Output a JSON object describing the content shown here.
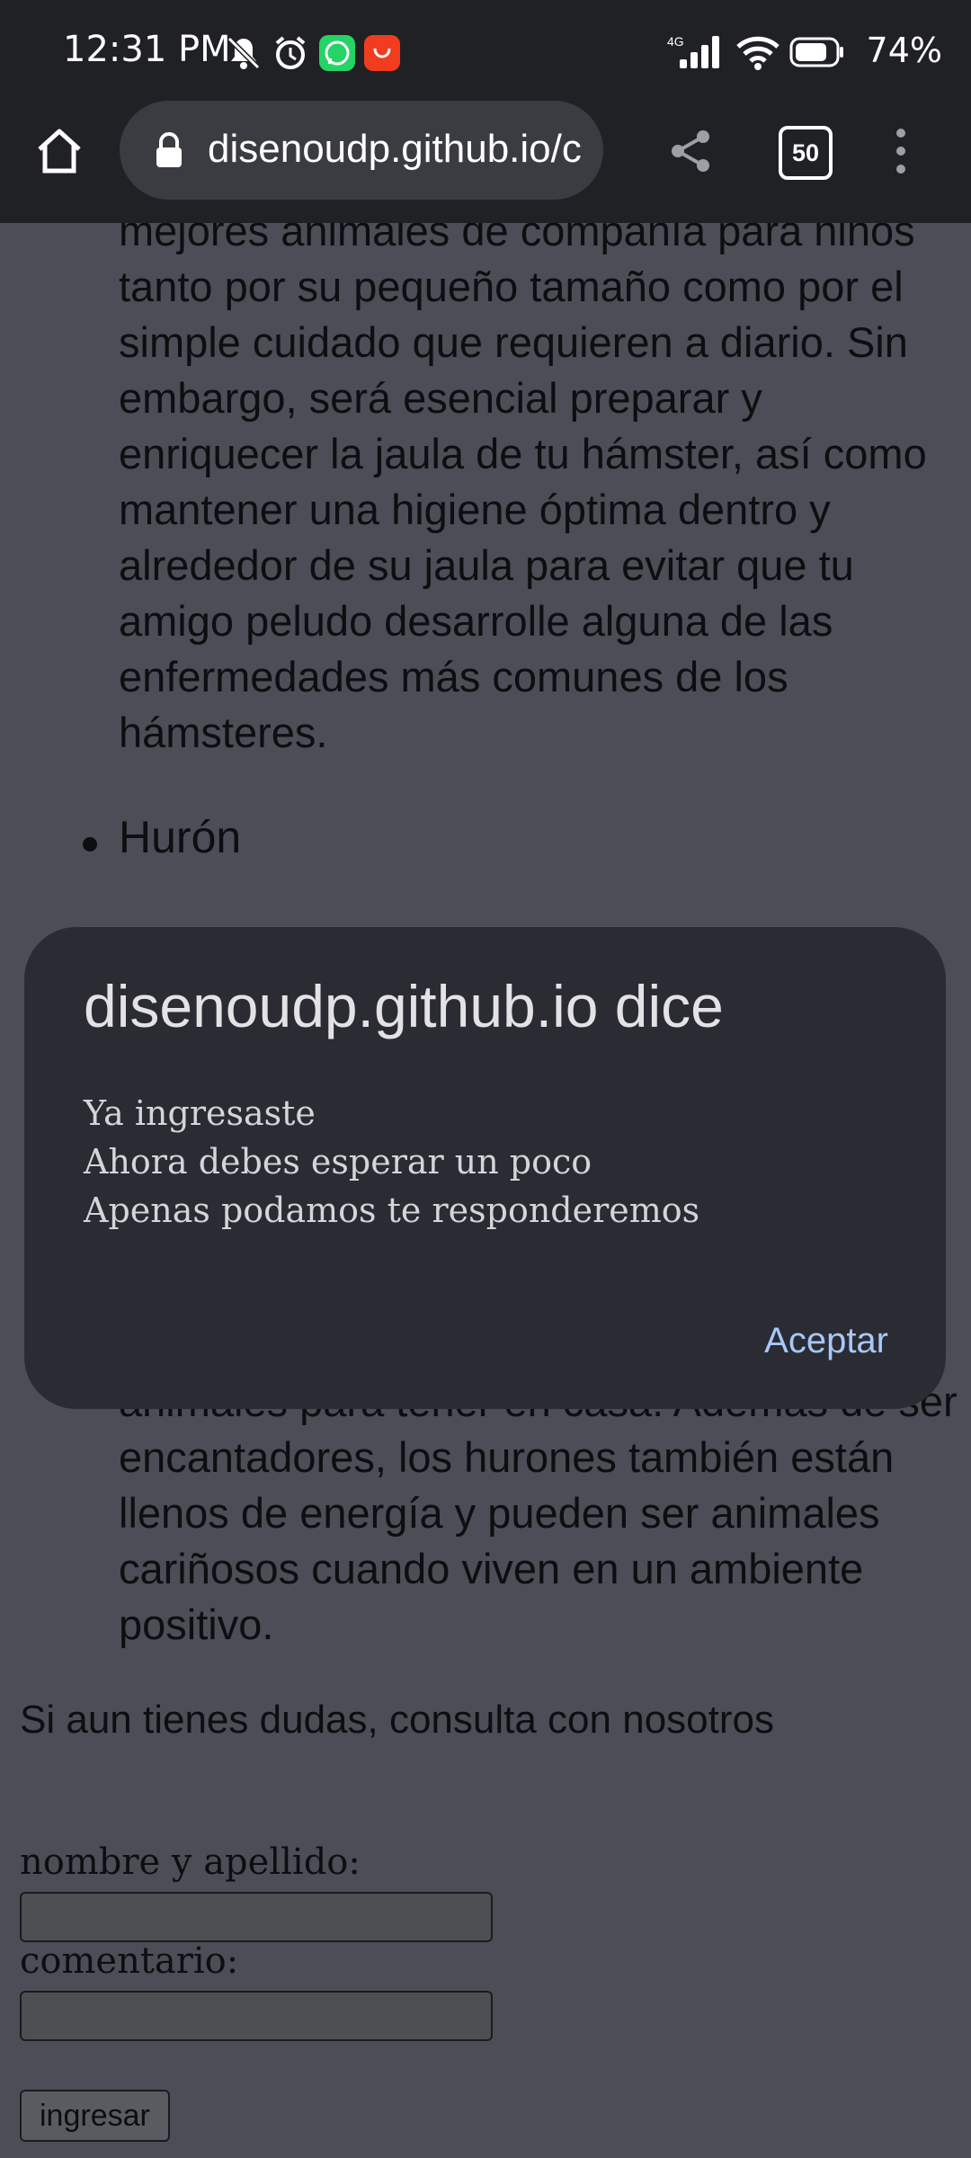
{
  "status_bar": {
    "time": "12:31 PM",
    "network": "4G",
    "battery": "74%",
    "icons": [
      "mute-icon",
      "alarm-icon",
      "whatsapp-icon",
      "shopping-app-icon",
      "signal-icon",
      "wifi-icon",
      "battery-icon"
    ]
  },
  "browser": {
    "url": "disenoudp.github.io/c",
    "tab_count": "50",
    "icons": [
      "home-icon",
      "lock-icon",
      "share-icon",
      "tabs-icon",
      "more-menu-icon"
    ]
  },
  "content": {
    "paragraph_top": "mejores animales de compañía para niños tanto por su pequeño tamaño como por el simple cuidado que requieren a diario. Sin embargo, será esencial preparar y enriquecer la jaula de tu hámster, así como mantener una higiene óptima dentro y alrededor de su jaula para evitar que tu amigo peludo desarrolle alguna de las enfermedades más comunes de los hámsteres.",
    "bullet_item": "Hurón",
    "paragraph_bottom": "animales para tener en casa. Además de ser encantadores, los hurones también están llenos de energía y pueden ser animales cariñosos cuando viven en un ambiente positivo.",
    "consult_text": "Si aun tienes dudas, consulta con nosotros"
  },
  "form": {
    "name_label": "nombre y apellido:",
    "name_value": "",
    "comment_label": "comentario:",
    "comment_value": "",
    "submit_label": "ingresar"
  },
  "dialog": {
    "title": "disenoudp.github.io dice",
    "message_lines": [
      "Ya ingresaste",
      "Ahora debes esperar un poco",
      "Apenas podamos te responderemos"
    ],
    "ok_label": "Aceptar"
  },
  "colors": {
    "system_bar": "#202124",
    "page_background": "#4b4e56",
    "dialog_background": "#2b2c33",
    "dialog_button": "#a8c7fa"
  }
}
